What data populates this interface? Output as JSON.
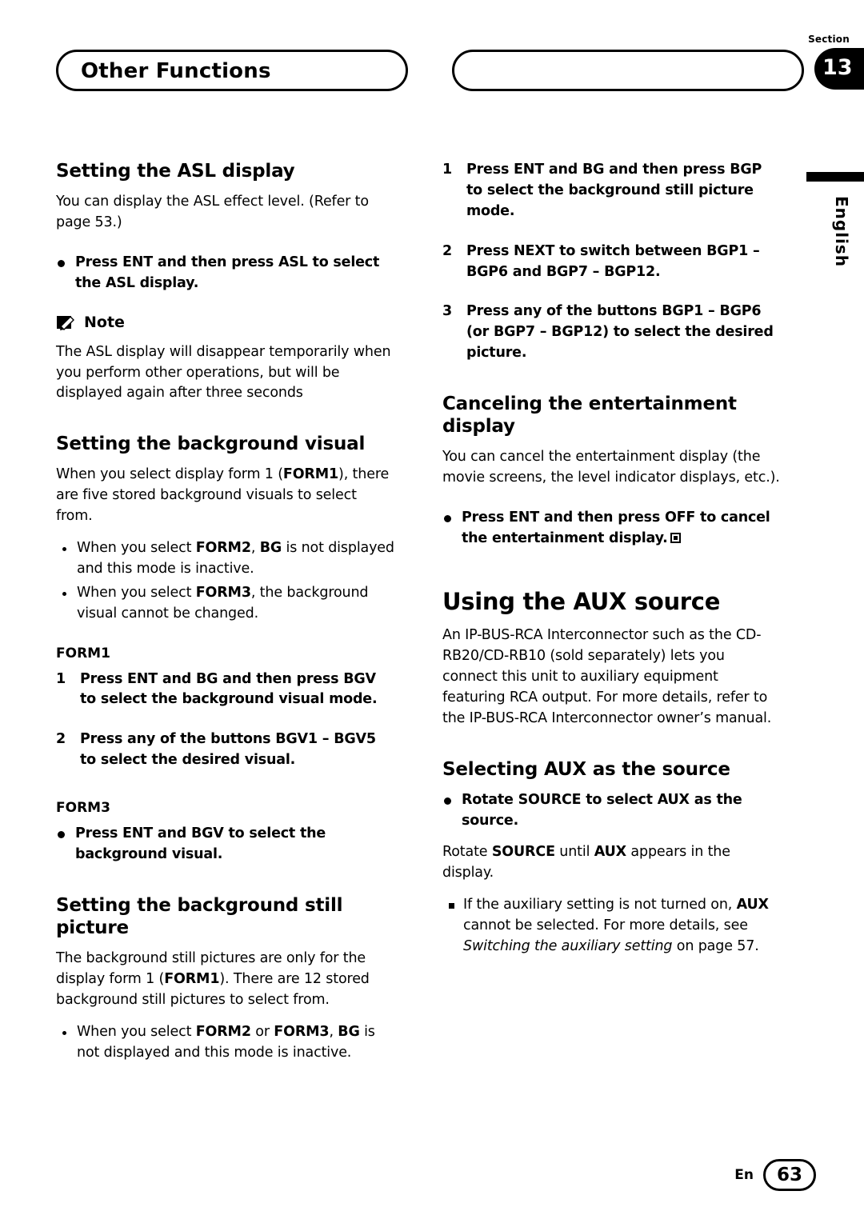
{
  "header": {
    "title": "Other Functions",
    "section_label": "Section",
    "section_number": "13",
    "language": "English"
  },
  "left_column": {
    "asl": {
      "heading": "Setting the ASL display",
      "intro": "You can display the ASL effect level. (Refer to page 53.)",
      "bullet": "Press ENT and then press ASL to select the ASL display.",
      "note_label": "Note",
      "note_text": "The ASL display will disappear temporarily when you perform other operations, but will be displayed again after three seconds"
    },
    "bg_visual": {
      "heading": "Setting the background visual",
      "intro": "When you select display form 1 (FORM1), there are five stored background visuals to select from.",
      "sub_bullets": [
        "When you select FORM2, BG is not displayed and this mode is inactive.",
        "When you select FORM3, the background visual cannot be changed."
      ],
      "form1_label": "FORM1",
      "form1_steps": [
        {
          "n": "1",
          "text": "Press ENT and BG and then press BGV to select the background visual mode."
        },
        {
          "n": "2",
          "text": "Press any of the buttons BGV1 – BGV5 to select the desired visual."
        }
      ],
      "form3_label": "FORM3",
      "form3_bullet": "Press ENT and BGV to select the background visual."
    },
    "bg_still": {
      "heading": "Setting the background still picture",
      "intro": "The background still pictures are only for the display form 1 (FORM1). There are 12 stored background still pictures to select from.",
      "sub_bullets": [
        "When you select FORM2 or FORM3, BG is not displayed and this mode is inactive."
      ]
    }
  },
  "right_column": {
    "bg_still_steps": [
      {
        "n": "1",
        "text": "Press ENT and BG and then press BGP to select the background still picture mode."
      },
      {
        "n": "2",
        "text": "Press NEXT to switch between BGP1 – BGP6 and BGP7 – BGP12."
      },
      {
        "n": "3",
        "text": "Press any of the buttons BGP1 – BGP6 (or BGP7 – BGP12) to select the desired picture."
      }
    ],
    "cancel": {
      "heading": "Canceling the entertainment display",
      "intro": "You can cancel the entertainment display (the movie screens, the level indicator displays, etc.).",
      "bullet": "Press ENT and then press OFF to cancel the entertainment display."
    },
    "aux": {
      "heading": "Using the AUX source",
      "intro": "An IP-BUS-RCA Interconnector such as the CD-RB20/CD-RB10 (sold separately) lets you connect this unit to auxiliary equipment featuring RCA output. For more details, refer to the IP-BUS-RCA Interconnector owner’s manual.",
      "sub_heading": "Selecting AUX as the source",
      "bullet": "Rotate SOURCE to select AUX as the source.",
      "body": "Rotate SOURCE until AUX appears in the display.",
      "note": "If the auxiliary setting is not turned on, AUX cannot be selected. For more details, see Switching the auxiliary setting on page 57."
    }
  },
  "footer": {
    "en": "En",
    "page": "63"
  }
}
